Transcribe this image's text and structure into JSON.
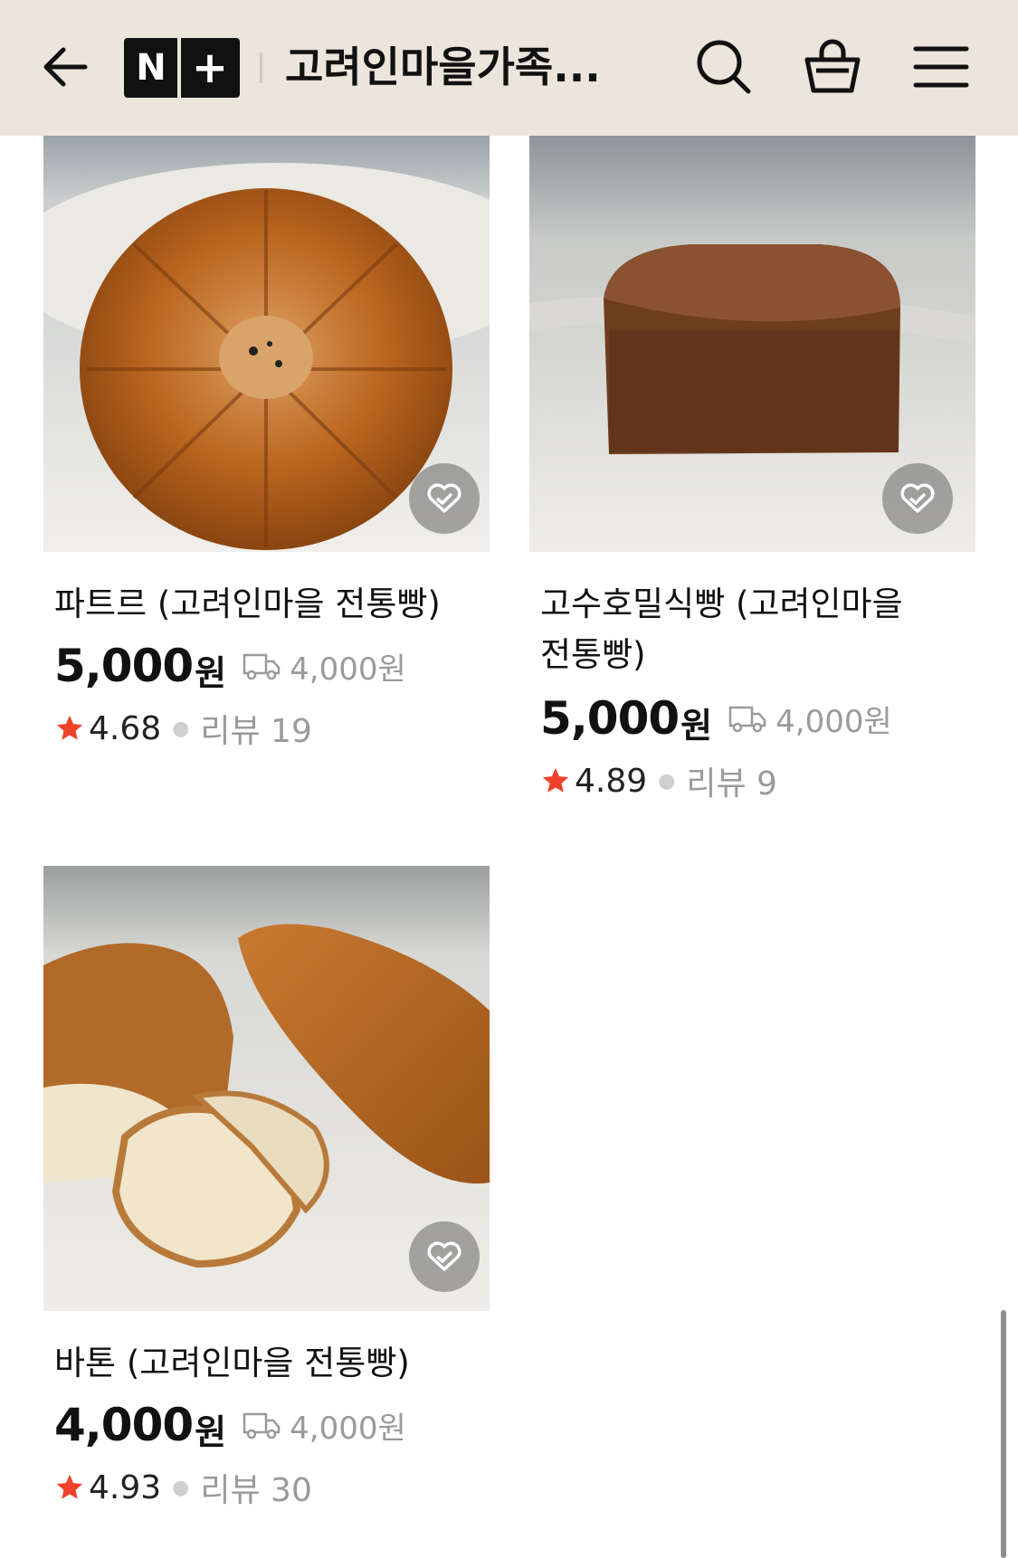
{
  "header": {
    "title": "고려인마을가족...",
    "logo_n": "N",
    "logo_plus": "+",
    "back_icon": "arrow-left-icon",
    "search_icon": "search-icon",
    "cart_icon": "shopping-basket-icon",
    "menu_icon": "hamburger-menu-icon"
  },
  "products": [
    {
      "name": "파트르 (고려인마을 전통빵)",
      "price": "5,000",
      "currency": "원",
      "shipping": "4,000원",
      "rating": "4.68",
      "review_label": "리뷰 19",
      "image": "patr-round-bread-photo"
    },
    {
      "name": "고수호밀식빵 (고려인마을 전통빵)",
      "price": "5,000",
      "currency": "원",
      "shipping": "4,000원",
      "rating": "4.89",
      "review_label": "리뷰 9",
      "image": "rye-loaf-photo"
    },
    {
      "name": "바톤 (고려인마을 전통빵)",
      "price": "4,000",
      "currency": "원",
      "shipping": "4,000원",
      "rating": "4.93",
      "review_label": "리뷰 30",
      "image": "baton-bread-photo"
    }
  ],
  "colors": {
    "header_bg": "#ece5dc",
    "star": "#f0412a",
    "muted": "#9a9a9a"
  }
}
